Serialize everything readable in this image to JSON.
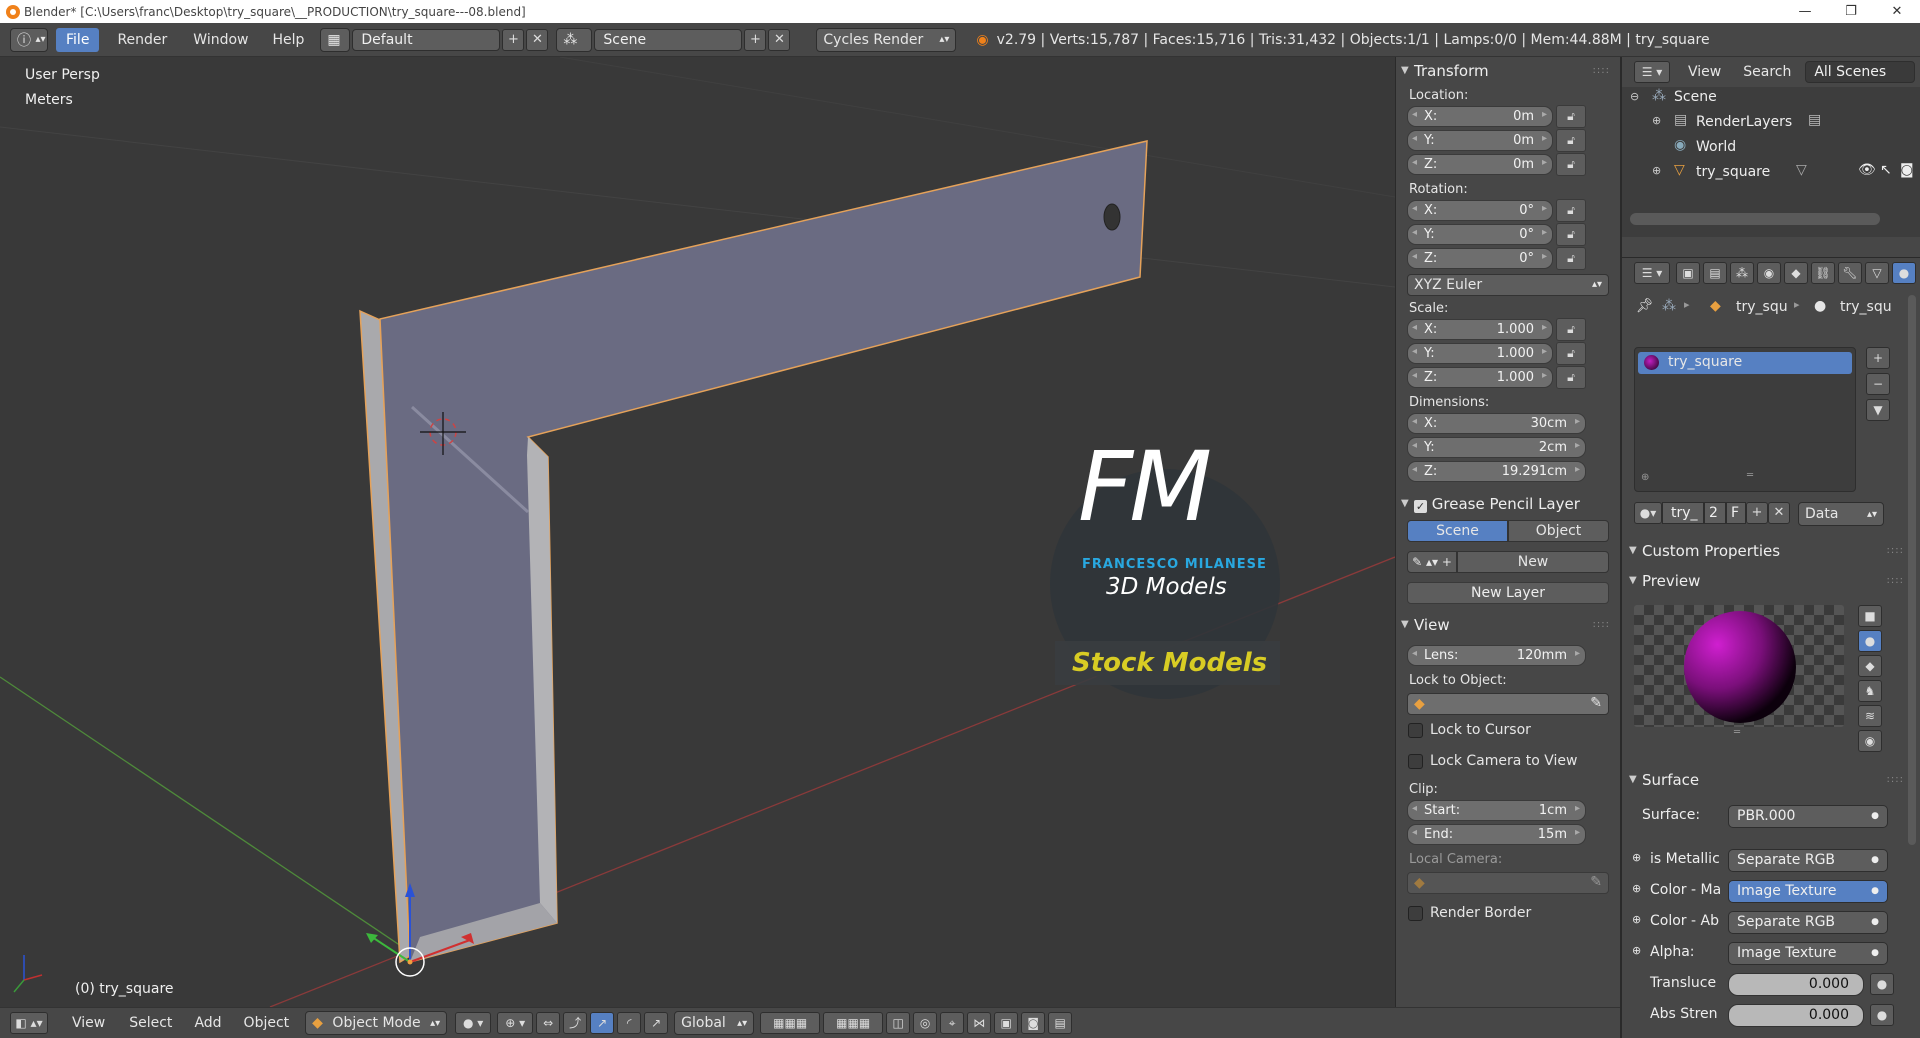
{
  "window": {
    "title": "Blender* [C:\\Users\\franc\\Desktop\\try_square\\__PRODUCTION\\try_square---08.blend]",
    "controls": [
      "—",
      "❐",
      "✕"
    ]
  },
  "info_header": {
    "menus": [
      "File",
      "Render",
      "Window",
      "Help"
    ],
    "layout": "Default",
    "scene": "Scene",
    "engine": "Cycles Render",
    "stats": "v2.79 | Verts:15,787 | Faces:15,716 | Tris:31,432 | Objects:1/1 | Lamps:0/0 | Mem:44.88M | try_square"
  },
  "viewport": {
    "view_name": "User Persp",
    "units": "Meters",
    "object_label": "(0) try_square",
    "watermark": {
      "initials": "FM",
      "author": "FRANCESCO MILANESE",
      "line": "3D Models",
      "banner": "Stock Models"
    }
  },
  "bottom_header": {
    "menus": [
      "View",
      "Select",
      "Add",
      "Object"
    ],
    "mode": "Object Mode",
    "orientation": "Global"
  },
  "transform": {
    "title": "Transform",
    "location_label": "Location:",
    "location": [
      {
        "axis": "X:",
        "value": "0m"
      },
      {
        "axis": "Y:",
        "value": "0m"
      },
      {
        "axis": "Z:",
        "value": "0m"
      }
    ],
    "rotation_label": "Rotation:",
    "rotation": [
      {
        "axis": "X:",
        "value": "0°"
      },
      {
        "axis": "Y:",
        "value": "0°"
      },
      {
        "axis": "Z:",
        "value": "0°"
      }
    ],
    "rotation_mode": "XYZ Euler",
    "scale_label": "Scale:",
    "scale": [
      {
        "axis": "X:",
        "value": "1.000"
      },
      {
        "axis": "Y:",
        "value": "1.000"
      },
      {
        "axis": "Z:",
        "value": "1.000"
      }
    ],
    "dimensions_label": "Dimensions:",
    "dimensions": [
      {
        "axis": "X:",
        "value": "30cm"
      },
      {
        "axis": "Y:",
        "value": "2cm"
      },
      {
        "axis": "Z:",
        "value": "19.291cm"
      }
    ]
  },
  "grease_pencil": {
    "title": "Grease Pencil Layer",
    "tab_scene": "Scene",
    "tab_object": "Object",
    "new_label": "New",
    "new_layer_label": "New Layer"
  },
  "view_panel": {
    "title": "View",
    "lens_label": "Lens:",
    "lens_value": "120mm",
    "lock_to_object_label": "Lock to Object:",
    "lock_to_cursor": "Lock to Cursor",
    "lock_camera": "Lock Camera to View",
    "clip_label": "Clip:",
    "clip_start_label": "Start:",
    "clip_start": "1cm",
    "clip_end_label": "End:",
    "clip_end": "15m",
    "local_camera_label": "Local Camera:",
    "render_border": "Render Border"
  },
  "outliner": {
    "menus": [
      "View",
      "Search"
    ],
    "filter": "All Scenes",
    "items": [
      "Scene",
      "RenderLayers",
      "World",
      "try_square"
    ]
  },
  "properties": {
    "breadcrumb_object": "try_squ",
    "breadcrumb_material": "try_squ",
    "material_slot": "try_square",
    "material_name": "try_",
    "users": "2",
    "fake_user": "F",
    "link": "Data",
    "custom_properties": "Custom Properties",
    "preview": "Preview",
    "surface_title": "Surface",
    "surface_label": "Surface:",
    "surface_value": "PBR.000",
    "inputs": [
      {
        "label": "is Metallic",
        "value": "Separate RGB"
      },
      {
        "label": "Color - Ma",
        "value": "Image Texture"
      },
      {
        "label": "Color - Ab",
        "value": "Separate RGB"
      },
      {
        "label": "Alpha:",
        "value": "Image Texture"
      }
    ],
    "sliders": [
      {
        "label": "Transluce",
        "value": "0.000"
      },
      {
        "label": "Abs Stren",
        "value": "0.000"
      }
    ]
  },
  "colors": {
    "accent": "#5680c2",
    "object_face": "#6a6b82",
    "selection_outline": "#e5a25a",
    "watermark_yellow": "#d8cc24",
    "watermark_blue": "#29a8e0"
  }
}
